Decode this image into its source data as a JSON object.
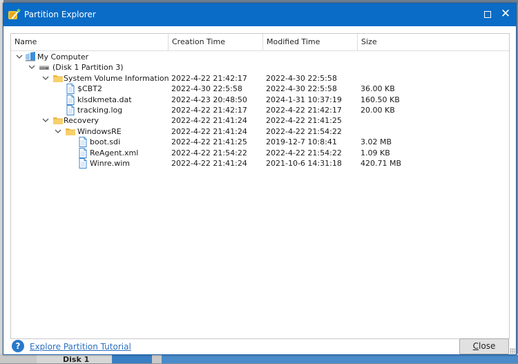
{
  "window": {
    "title": "Partition Explorer",
    "accent_color": "#0a6cc6"
  },
  "columns": [
    "Name",
    "Creation Time",
    "Modified Time",
    "Size"
  ],
  "tree": [
    {
      "name": "My Computer",
      "icon": "computer-icon",
      "level": 0,
      "expanded": true,
      "created": "",
      "modified": "",
      "size": ""
    },
    {
      "name": "(Disk 1 Partition 3)",
      "icon": "drive-icon",
      "level": 1,
      "expanded": true,
      "created": "",
      "modified": "",
      "size": ""
    },
    {
      "name": "System Volume Information",
      "icon": "folder-icon",
      "level": 2,
      "expanded": true,
      "created": "2022-4-22 21:42:17",
      "modified": "2022-4-30 22:5:58",
      "size": ""
    },
    {
      "name": "$CBT2",
      "icon": "file-icon",
      "level": 3,
      "created": "2022-4-30 22:5:58",
      "modified": "2022-4-30 22:5:58",
      "size": "36.00 KB"
    },
    {
      "name": "klsdkmeta.dat",
      "icon": "file-icon",
      "level": 3,
      "created": "2022-4-23 20:48:50",
      "modified": "2024-1-31 10:37:19",
      "size": "160.50 KB"
    },
    {
      "name": "tracking.log",
      "icon": "file-icon",
      "level": 3,
      "created": "2022-4-22 21:42:17",
      "modified": "2022-4-22 21:42:17",
      "size": "20.00 KB"
    },
    {
      "name": "Recovery",
      "icon": "folder-icon",
      "level": 2,
      "expanded": true,
      "created": "2022-4-22 21:41:24",
      "modified": "2022-4-22 21:41:25",
      "size": ""
    },
    {
      "name": "WindowsRE",
      "icon": "folder-icon",
      "level": 3,
      "expanded": true,
      "created": "2022-4-22 21:41:24",
      "modified": "2022-4-22 21:54:22",
      "size": ""
    },
    {
      "name": "boot.sdi",
      "icon": "file-icon",
      "level": 4,
      "created": "2022-4-22 21:41:25",
      "modified": "2019-12-7 10:8:41",
      "size": "3.02 MB"
    },
    {
      "name": "ReAgent.xml",
      "icon": "file-icon",
      "level": 4,
      "created": "2022-4-22 21:54:22",
      "modified": "2022-4-22 21:54:22",
      "size": "1.09 KB"
    },
    {
      "name": "Winre.wim",
      "icon": "file-icon",
      "level": 4,
      "created": "2022-4-22 21:41:24",
      "modified": "2021-10-6 14:31:18",
      "size": "420.71 MB"
    }
  ],
  "footer": {
    "help_icon": "?",
    "tutorial_link": "Explore Partition Tutorial",
    "close_mnemonic": "C",
    "close_rest": "lose"
  },
  "background": {
    "tab_label": "Disk 1"
  }
}
